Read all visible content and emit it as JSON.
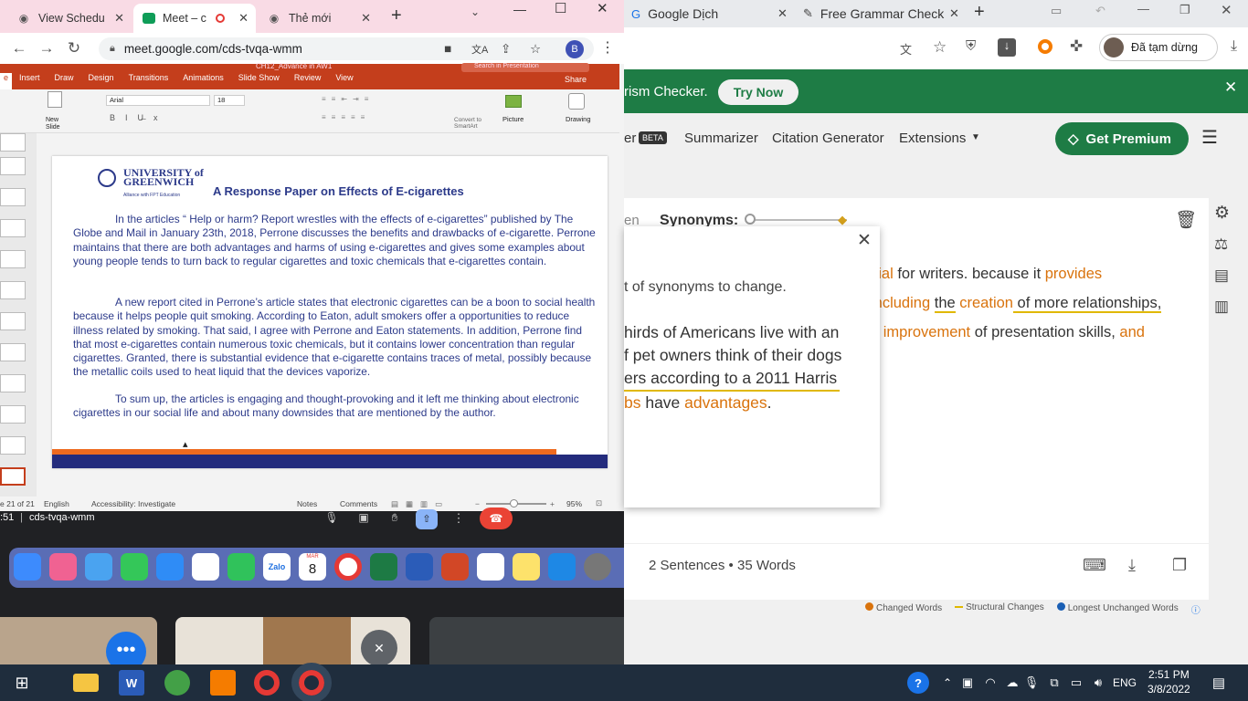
{
  "left_browser": {
    "tabs": [
      {
        "label": "View Schedu"
      },
      {
        "label": "Meet – c"
      },
      {
        "label": "Thẻ mới"
      }
    ],
    "url": "meet.google.com/cds-tvqa-wmm",
    "profile_initial": "B"
  },
  "ppt": {
    "ribbon_tabs": [
      "Insert",
      "Draw",
      "Design",
      "Transitions",
      "Animations",
      "Slide Show",
      "Review",
      "View"
    ],
    "doc_title": "CH12_Advance in AW1",
    "search_placeholder": "Search in Presentation",
    "share_label": "Share",
    "font_name": "Arial",
    "font_size": "18",
    "new_slide_label": "New Slide",
    "picture_label": "Picture",
    "drawing_label": "Drawing",
    "convert_label": "Convert to SmartArt",
    "slide": {
      "logo_line1": "UNIVERSITY of",
      "logo_line2": "GREENWICH",
      "logo_line3": "Alliance with FPT Education",
      "title": "A Response Paper on Effects of E-cigarettes",
      "p1": "In the articles “ Help or harm? Report wrestles with the effects of e-cigarettes” published by The Globe and Mail in January 23th, 2018, Perrone discusses the benefits and drawbacks of e-cigarette. Perrone maintains that there are both advantages and harms of using e-cigarettes and gives some examples about young people tends to turn back to regular cigarettes and toxic chemicals that e-cigarettes contain.",
      "p2": "A new report cited in Perrone’s article states that electronic cigarettes can be a boon to social health because it helps people quit smoking. According to Eaton, adult smokers offer a opportunities to reduce illness related by smoking. That said, I agree with Perrone and Eaton statements. In addition, Perrone find that most e-cigarettes contain numerous toxic chemicals, but it contains lower concentration than regular cigarettes. Granted, there is substantial evidence that e-cigarette contains traces of metal, possibly because the metallic coils used to heat liquid that the devices vaporize.",
      "p3": "To sum up, the articles is engaging and thought-provoking and it left me thinking about electronic cigarettes in our social life and about many downsides that are mentioned by the author."
    },
    "status": {
      "slide_info": "e 21 of 21",
      "language": "English",
      "accessibility": "Accessibility: Investigate",
      "notes": "Notes",
      "comments": "Comments",
      "zoom": "95%"
    }
  },
  "meet": {
    "time": ":51",
    "code": "cds-tvqa-wmm"
  },
  "dock_calendar": {
    "month": "MAR",
    "day": "8"
  },
  "right_browser": {
    "tabs": [
      {
        "label": "Google Dịch"
      },
      {
        "label": "Free Grammar Check"
      }
    ],
    "paused_label": "Đã tạm dừng",
    "banner_text": "rism Checker.",
    "try_now": "Try Now",
    "nav": {
      "beta": "BETA",
      "summarizer": "Summarizer",
      "citation": "Citation Generator",
      "extensions": "Extensions",
      "premium": "Get Premium"
    },
    "synonyms_label": "Synonyms:",
    "tab_partial": "en",
    "output_lines": [
      {
        "parts": [
          {
            "t": "cial",
            "c": "orange"
          },
          {
            "t": " for writers. because it ",
            "c": "plain"
          },
          {
            "t": "provides",
            "c": "orange"
          }
        ]
      },
      {
        "parts": [
          {
            "t": "including",
            "c": "orange"
          },
          {
            "t": " ",
            "c": "plain"
          },
          {
            "t": "the",
            "c": "under"
          },
          {
            "t": " ",
            "c": "plain"
          },
          {
            "t": "creation",
            "c": "orange"
          },
          {
            "t": " of more relationships,",
            "c": "under"
          }
        ]
      },
      {
        "parts": [
          {
            "t": "e ",
            "c": "plain"
          },
          {
            "t": "improvement",
            "c": "orange"
          },
          {
            "t": " of presentation skills, ",
            "c": "plain"
          },
          {
            "t": "and",
            "c": "orange"
          }
        ]
      }
    ],
    "popup": {
      "line0": "t of synonyms to change.",
      "line1": "hirds of Americans live with an",
      "line2": "f pet owners think of their dogs",
      "line3": "ers according to a 2011 Harris",
      "line4a": "bs",
      "line4b": " have ",
      "line4c": "advantages",
      "line4d": "."
    },
    "stats": "2 Sentences • 35 Words",
    "legend": {
      "changed": "Changed Words",
      "structural": "Structural Changes",
      "longest": "Longest Unchanged Words"
    }
  },
  "taskbar": {
    "lang": "ENG",
    "time": "2:51 PM",
    "date": "3/8/2022"
  },
  "colors": {
    "ppt_red": "#c43e1c",
    "qb_green": "#1e7c45",
    "orange": "#d9730d",
    "slide_text": "#2c3a8a"
  }
}
